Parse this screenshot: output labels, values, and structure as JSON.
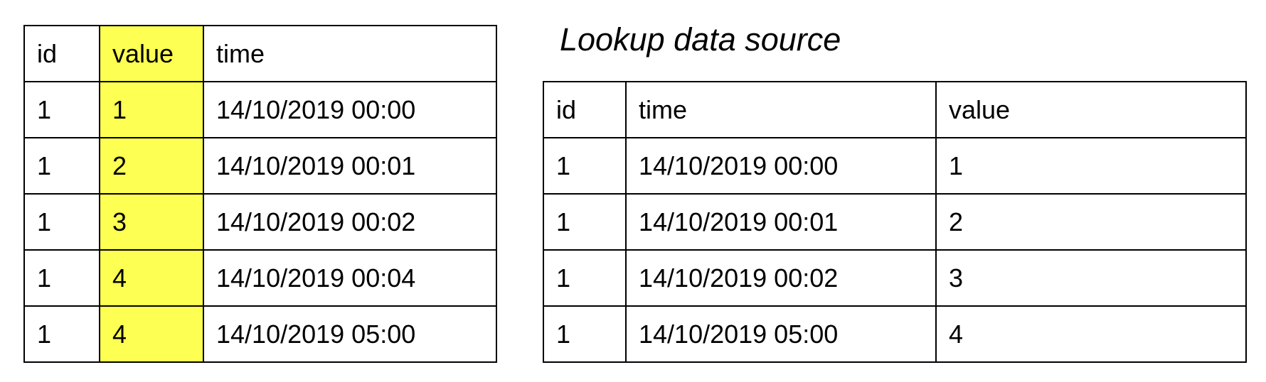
{
  "highlight_color": "#fdff52",
  "left_table": {
    "headers": [
      "id",
      "value",
      "time"
    ],
    "rows": [
      [
        "1",
        "1",
        "14/10/2019 00:00"
      ],
      [
        "1",
        "2",
        "14/10/2019 00:01"
      ],
      [
        "1",
        "3",
        "14/10/2019 00:02"
      ],
      [
        "1",
        "4",
        "14/10/2019 00:04"
      ],
      [
        "1",
        "4",
        "14/10/2019 05:00"
      ]
    ],
    "highlighted_column": "value"
  },
  "right_table": {
    "title": "Lookup data source",
    "headers": [
      "id",
      "time",
      "value"
    ],
    "rows": [
      [
        "1",
        "14/10/2019 00:00",
        "1"
      ],
      [
        "1",
        "14/10/2019 00:01",
        "2"
      ],
      [
        "1",
        "14/10/2019 00:02",
        "3"
      ],
      [
        "1",
        "14/10/2019 05:00",
        "4"
      ]
    ]
  }
}
